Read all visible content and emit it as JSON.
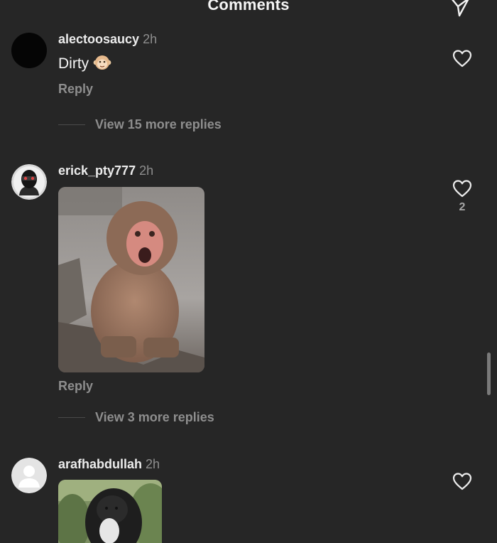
{
  "header": {
    "title": "Comments",
    "share_icon": "paper-plane-icon"
  },
  "comments": [
    {
      "username": "alectoosaucy",
      "time": "2h",
      "text": "Dirty",
      "emoji": "monkey-face-emoji",
      "reply_label": "Reply",
      "view_replies_label": "View 15 more replies",
      "like_icon": "heart-icon",
      "avatar": "black-circle-avatar"
    },
    {
      "username": "erick_pty777",
      "time": "2h",
      "media": "shocked-monkey-gif",
      "reply_label": "Reply",
      "view_replies_label": "View 3 more replies",
      "like_icon": "heart-icon",
      "like_count": "2",
      "avatar": "masked-face-avatar"
    },
    {
      "username": "arafhabdullah",
      "time": "2h",
      "media": "gorilla-gif",
      "like_icon": "heart-icon",
      "avatar": "default-profile-avatar"
    }
  ],
  "colors": {
    "background": "#262626",
    "primary_text": "#f5f5f5",
    "secondary_text": "#8e8e8e"
  }
}
